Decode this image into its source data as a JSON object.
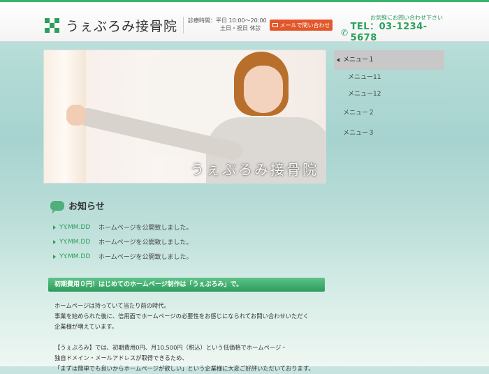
{
  "header": {
    "logo_text": "うぇぶろみ接骨院",
    "hours_line1": "診療時間：平日 10:00〜20:00",
    "hours_line2": "土日・祝日 休診",
    "mail_button": "メールで問い合わせ",
    "contact_note": "お気軽にお問い合わせ下さい",
    "tel": "TEL：03-1234-5678"
  },
  "hero": {
    "title": "うぇぶろみ接骨院"
  },
  "menu": {
    "items": [
      {
        "label": "メニュー１"
      },
      {
        "label": "メニュー11"
      },
      {
        "label": "メニュー12"
      },
      {
        "label": "メニュー２"
      },
      {
        "label": "メニュー３"
      }
    ]
  },
  "news": {
    "title": "お知らせ",
    "items": [
      {
        "date": "YY.MM.DD",
        "text": "ホームページを公開致しました。"
      },
      {
        "date": "YY.MM.DD",
        "text": "ホームページを公開致しました。"
      },
      {
        "date": "YY.MM.DD",
        "text": "ホームページを公開致しました。"
      }
    ]
  },
  "section": {
    "heading": "初期費用０円！はじめてのホームページ制作は「うぇぶろみ」で。",
    "p1_l1": "ホームページは持っていて当たり前の時代。",
    "p1_l2": "事業を始められた後に、信用面でホームページの必要性をお感じになられてお問い合わせいただく",
    "p1_l3": "企業様が増えています。",
    "p2_l1": "【うぇぶろみ】では、初期費用0円、月10,500円（税込）という低価格でホームページ・",
    "p2_l2": "独自ドメイン・メールアドレスが取得できるため、",
    "p2_l3": "「まずは簡単でも良いからホームページが欲しい」という企業様に大変ご好評いただいております。"
  },
  "colors": {
    "accent": "#2aa05a",
    "mail_button": "#e2572a",
    "menu_active": "#c8c8c8"
  }
}
